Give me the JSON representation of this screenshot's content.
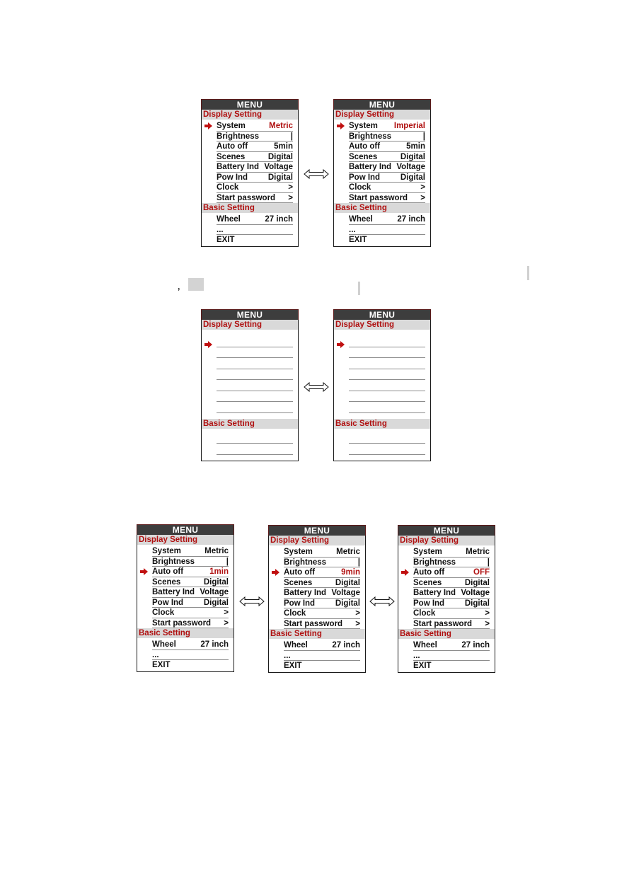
{
  "menu_title": "MENU",
  "section_display": "Display Setting",
  "section_basic": "Basic Setting",
  "colors": {
    "header_bg": "#3d3d3d",
    "section_bg": "#d9d9d9",
    "accent_red": "#b01010",
    "rule_gray": "#8c8c8c"
  },
  "icons": {
    "pointer": "right-arrow-icon",
    "transition": "double-arrow-icon"
  },
  "panels": [
    {
      "id": "system-metric",
      "display_rows": [
        {
          "label": "System",
          "value": "Metric",
          "selected": true
        },
        {
          "label": "Brightness",
          "value": "|"
        },
        {
          "label": "Auto off",
          "value": "5min"
        },
        {
          "label": "Scenes",
          "value": "Digital"
        },
        {
          "label": "Battery Ind",
          "value": "Voltage"
        },
        {
          "label": "Pow Ind",
          "value": "Digital"
        },
        {
          "label": "Clock",
          "value": ">"
        },
        {
          "label": "Start password",
          "value": ">"
        }
      ],
      "basic_rows": [
        {
          "label": "Wheel",
          "value": "27 inch"
        },
        {
          "label": "...",
          "value": ""
        },
        {
          "label": "EXIT",
          "value": ""
        }
      ]
    },
    {
      "id": "system-imperial",
      "display_rows": [
        {
          "label": "System",
          "value": "Imperial",
          "selected": true
        },
        {
          "label": "Brightness",
          "value": "|"
        },
        {
          "label": "Auto off",
          "value": "5min"
        },
        {
          "label": "Scenes",
          "value": "Digital"
        },
        {
          "label": "Battery Ind",
          "value": "Voltage"
        },
        {
          "label": "Pow Ind",
          "value": "Digital"
        },
        {
          "label": "Clock",
          "value": ">"
        },
        {
          "label": "Start password",
          "value": ">"
        }
      ],
      "basic_rows": [
        {
          "label": "Wheel",
          "value": "27 inch"
        },
        {
          "label": "...",
          "value": ""
        },
        {
          "label": "EXIT",
          "value": ""
        }
      ]
    },
    {
      "id": "brightness-blank-a",
      "blank": true,
      "display_rows": [
        {
          "selected": true
        },
        {},
        {},
        {},
        {},
        {},
        {}
      ],
      "basic_rows": [
        {},
        {}
      ]
    },
    {
      "id": "brightness-blank-b",
      "blank": true,
      "display_rows": [
        {
          "selected": true
        },
        {},
        {},
        {},
        {},
        {},
        {}
      ],
      "basic_rows": [
        {},
        {}
      ]
    },
    {
      "id": "autooff-1min",
      "display_rows": [
        {
          "label": "System",
          "value": "Metric"
        },
        {
          "label": "Brightness",
          "value": "|"
        },
        {
          "label": "Auto off",
          "value": "1min",
          "selected": true
        },
        {
          "label": "Scenes",
          "value": "Digital"
        },
        {
          "label": "Battery Ind",
          "value": "Voltage"
        },
        {
          "label": "Pow Ind",
          "value": "Digital"
        },
        {
          "label": "Clock",
          "value": ">"
        },
        {
          "label": "Start password",
          "value": ">"
        }
      ],
      "basic_rows": [
        {
          "label": "Wheel",
          "value": "27 inch"
        },
        {
          "label": "...",
          "value": ""
        },
        {
          "label": "EXIT",
          "value": ""
        }
      ]
    },
    {
      "id": "autooff-9min",
      "display_rows": [
        {
          "label": "System",
          "value": "Metric"
        },
        {
          "label": "Brightness",
          "value": "|"
        },
        {
          "label": "Auto off",
          "value": "9min",
          "selected": true
        },
        {
          "label": "Scenes",
          "value": "Digital"
        },
        {
          "label": "Battery Ind",
          "value": "Voltage"
        },
        {
          "label": "Pow Ind",
          "value": "Digital"
        },
        {
          "label": "Clock",
          "value": ">"
        },
        {
          "label": "Start password",
          "value": ">"
        }
      ],
      "basic_rows": [
        {
          "label": "Wheel",
          "value": "27 inch"
        },
        {
          "label": "...",
          "value": ""
        },
        {
          "label": "EXIT",
          "value": ""
        }
      ]
    },
    {
      "id": "autooff-off",
      "display_rows": [
        {
          "label": "System",
          "value": "Metric"
        },
        {
          "label": "Brightness",
          "value": "|"
        },
        {
          "label": "Auto off",
          "value": "OFF",
          "selected": true
        },
        {
          "label": "Scenes",
          "value": "Digital"
        },
        {
          "label": "Battery Ind",
          "value": "Voltage"
        },
        {
          "label": "Pow Ind",
          "value": "Digital"
        },
        {
          "label": "Clock",
          "value": ">"
        },
        {
          "label": "Start password",
          "value": ">"
        }
      ],
      "basic_rows": [
        {
          "label": "Wheel",
          "value": "27 inch"
        },
        {
          "label": "...",
          "value": ""
        },
        {
          "label": "EXIT",
          "value": ""
        }
      ]
    }
  ],
  "marks": {
    "comma": ","
  }
}
